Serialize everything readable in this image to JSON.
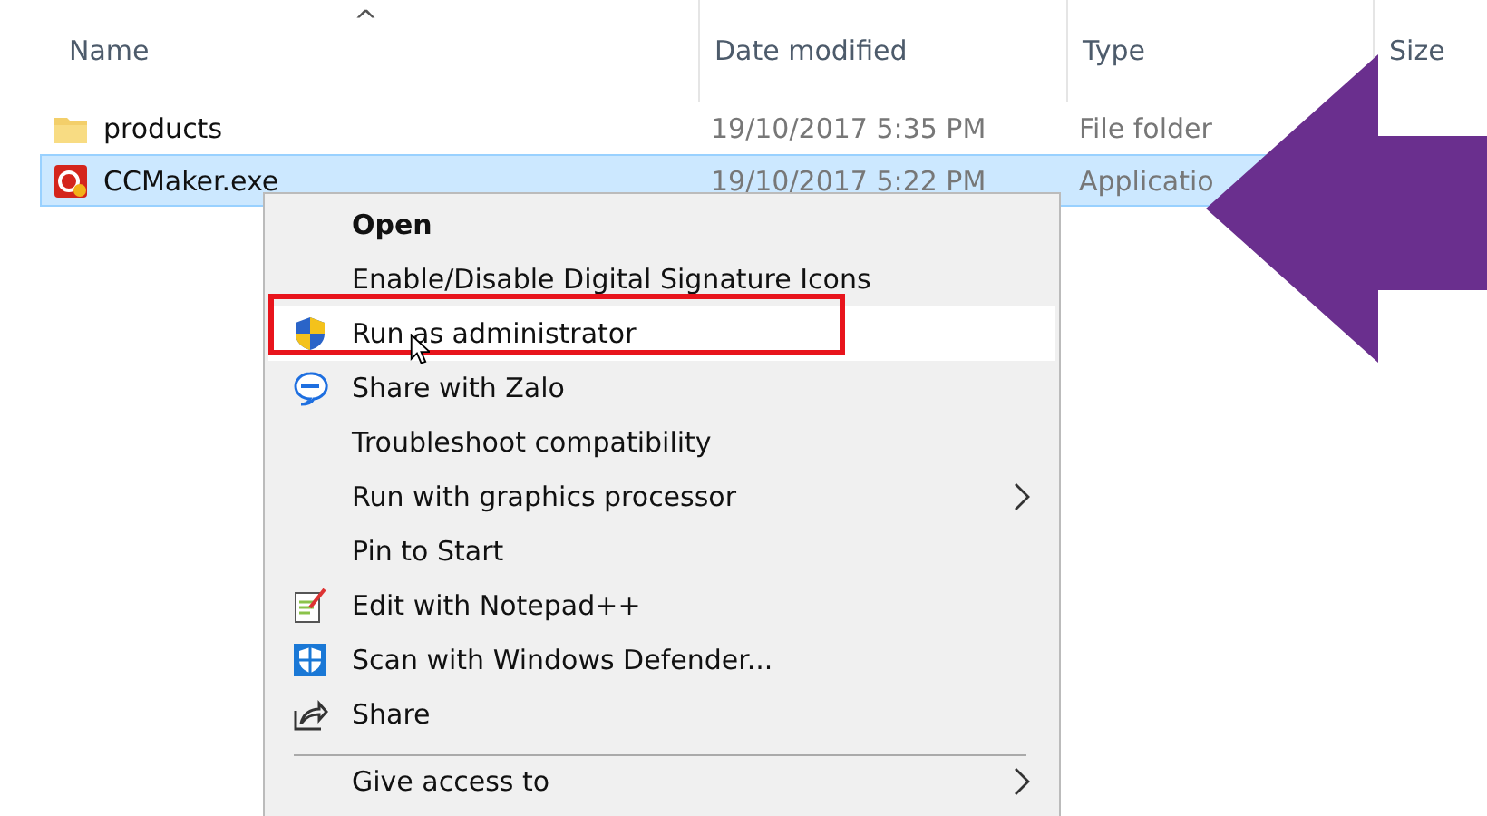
{
  "columns": [
    {
      "label": "Name"
    },
    {
      "label": "Date modified"
    },
    {
      "label": "Type"
    },
    {
      "label": "Size"
    }
  ],
  "sort_indicator": "^",
  "files": [
    {
      "kind": "folder",
      "name": "products",
      "date": "19/10/2017 5:35 PM",
      "type": "File folder",
      "selected": false
    },
    {
      "kind": "app",
      "name": "CCMaker.exe",
      "date": "19/10/2017 5:22 PM",
      "type": "Applicatio",
      "selected": true
    }
  ],
  "context_menu": {
    "items": [
      {
        "label": "Open",
        "kind": "plain",
        "default": true,
        "selected": false,
        "submenu": false,
        "separator_before": false
      },
      {
        "label": "Enable/Disable Digital Signature Icons",
        "kind": "plain",
        "default": false,
        "selected": false,
        "submenu": false,
        "separator_before": false
      },
      {
        "label": "Run as administrator",
        "kind": "shield",
        "default": false,
        "selected": true,
        "submenu": false,
        "separator_before": false
      },
      {
        "label": "Share with Zalo",
        "kind": "chat",
        "default": false,
        "selected": false,
        "submenu": false,
        "separator_before": false
      },
      {
        "label": "Troubleshoot compatibility",
        "kind": "plain",
        "default": false,
        "selected": false,
        "submenu": false,
        "separator_before": false
      },
      {
        "label": "Run with graphics processor",
        "kind": "plain",
        "default": false,
        "selected": false,
        "submenu": true,
        "separator_before": false
      },
      {
        "label": "Pin to Start",
        "kind": "plain",
        "default": false,
        "selected": false,
        "submenu": false,
        "separator_before": false
      },
      {
        "label": "Edit with Notepad++",
        "kind": "notepad",
        "default": false,
        "selected": false,
        "submenu": false,
        "separator_before": false
      },
      {
        "label": "Scan with Windows Defender...",
        "kind": "defender",
        "default": false,
        "selected": false,
        "submenu": false,
        "separator_before": false
      },
      {
        "label": "Share",
        "kind": "share",
        "default": false,
        "selected": false,
        "submenu": false,
        "separator_before": false
      },
      {
        "label": "Give access to",
        "kind": "plain",
        "default": false,
        "selected": false,
        "submenu": true,
        "separator_before": true
      }
    ]
  }
}
